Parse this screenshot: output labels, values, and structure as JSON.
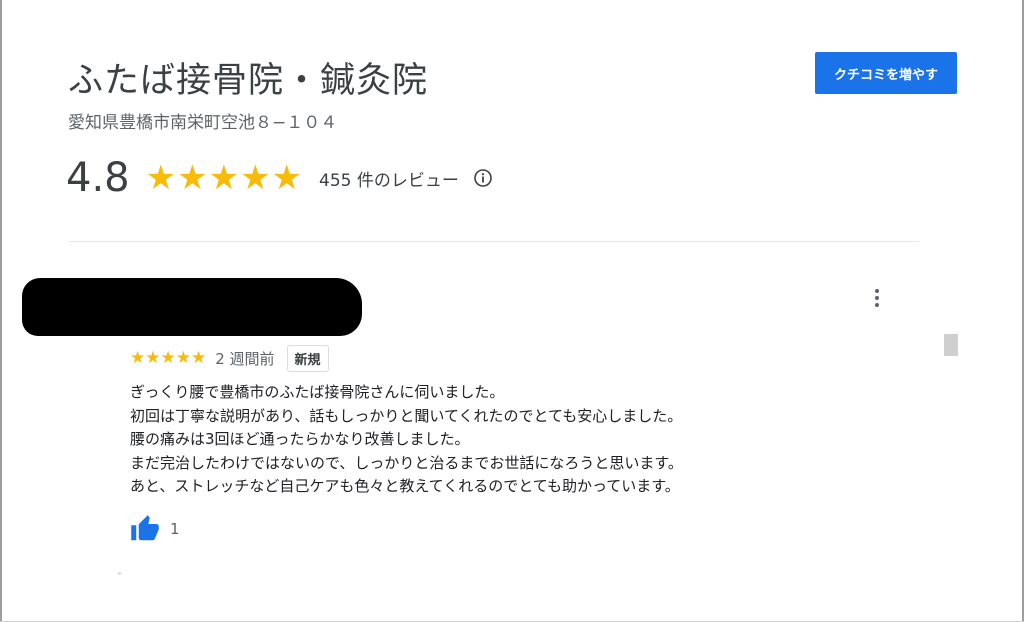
{
  "place": {
    "name": "ふたば接骨院・鍼灸院",
    "address": "愛知県豊橋市南栄町空池８−１０４"
  },
  "summary": {
    "rating": "4.8",
    "stars": "★★★★★",
    "review_count_text": "455 件のレビュー",
    "info_icon": "info-icon"
  },
  "actions": {
    "write_review_label": "クチコミを増やす"
  },
  "review": {
    "stars": "★★★★★",
    "rating_value": 5,
    "time_ago": "2 週間前",
    "badge": "新規",
    "lines": [
      "ぎっくり腰で豊橋市のふたば接骨院さんに伺いました。",
      "初回は丁寧な説明があり、話もしっかりと聞いてくれたのでとても安心しました。",
      "腰の痛みは3回ほど通ったらかなり改善しました。",
      "まだ完治したわけではないので、しっかりと治るまでお世話になろうと思います。",
      "あと、ストレッチなど自己ケアも色々と教えてくれるのでとても助かっています。"
    ],
    "likes": "1"
  },
  "colors": {
    "accent": "#1a73e8",
    "star": "#f9bb0a",
    "text_secondary": "#5f6368"
  }
}
